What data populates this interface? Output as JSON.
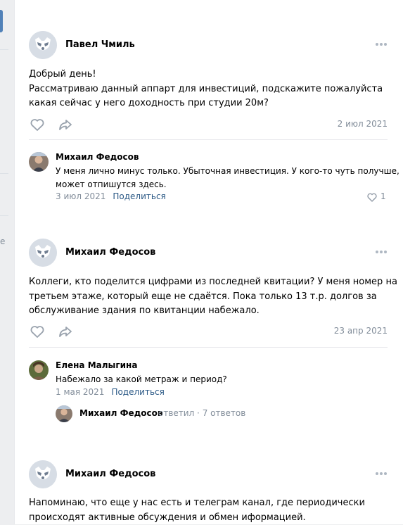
{
  "colors": {
    "accent": "#5181b8",
    "link": "#2a5885",
    "muted": "#818c99",
    "background": "#edeef0"
  },
  "left_fragment": "e",
  "posts": [
    {
      "author": "Павел Чмиль",
      "avatar_icon": "default-avatar-icon",
      "text": [
        "Добрый день!",
        "Рассматриваю данный аппарт для инвестиций, подскажите пожалуйста",
        "какая сейчас у него доходность при студии 20м?"
      ],
      "date": "2 июл 2021",
      "comment": {
        "author": "Михаил Федосов",
        "text": [
          "У меня лично минус только. Убыточная инвестиция. У кого-то чуть получше,",
          "может отпишутся здесь."
        ],
        "date": "3 июл 2021",
        "share_label": "Поделиться",
        "likes": "1"
      }
    },
    {
      "author": "Михаил Федосов",
      "avatar_icon": "default-avatar-icon",
      "text": [
        "Коллеги, кто поделится цифрами из последней квитации? У меня номер на",
        "третьем этаже, который еще не сдаётся. Пока только 13 т.р. долгов за",
        "обслуживание здания по квитанции набежало."
      ],
      "date": "23 апр 2021",
      "comment": {
        "author": "Елена Малыгина",
        "text": [
          "Набежало за какой метраж и период?"
        ],
        "date": "1 мая 2021",
        "share_label": "Поделиться",
        "reply_thread": {
          "author": "Михаил Федосов",
          "meta": "ответил · 7 ответов"
        }
      }
    },
    {
      "author": "Михаил Федосов",
      "avatar_icon": "default-avatar-icon",
      "text": [
        "Напоминаю, что еще у нас есть и телеграм канал, где периодически",
        "происходят активные обсуждения и обмен иформацией."
      ]
    }
  ]
}
